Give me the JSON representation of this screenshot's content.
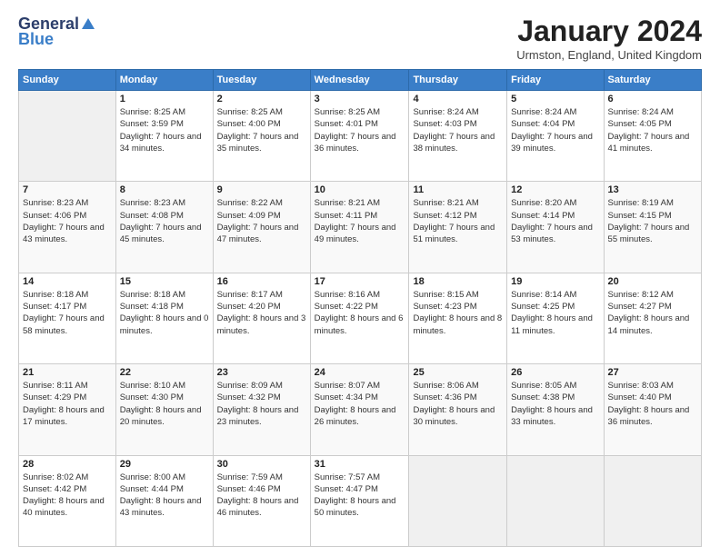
{
  "logo": {
    "general": "General",
    "blue": "Blue"
  },
  "header": {
    "month": "January 2024",
    "location": "Urmston, England, United Kingdom"
  },
  "days_of_week": [
    "Sunday",
    "Monday",
    "Tuesday",
    "Wednesday",
    "Thursday",
    "Friday",
    "Saturday"
  ],
  "weeks": [
    [
      {
        "num": "",
        "sunrise": "",
        "sunset": "",
        "daylight": ""
      },
      {
        "num": "1",
        "sunrise": "Sunrise: 8:25 AM",
        "sunset": "Sunset: 3:59 PM",
        "daylight": "Daylight: 7 hours and 34 minutes."
      },
      {
        "num": "2",
        "sunrise": "Sunrise: 8:25 AM",
        "sunset": "Sunset: 4:00 PM",
        "daylight": "Daylight: 7 hours and 35 minutes."
      },
      {
        "num": "3",
        "sunrise": "Sunrise: 8:25 AM",
        "sunset": "Sunset: 4:01 PM",
        "daylight": "Daylight: 7 hours and 36 minutes."
      },
      {
        "num": "4",
        "sunrise": "Sunrise: 8:24 AM",
        "sunset": "Sunset: 4:03 PM",
        "daylight": "Daylight: 7 hours and 38 minutes."
      },
      {
        "num": "5",
        "sunrise": "Sunrise: 8:24 AM",
        "sunset": "Sunset: 4:04 PM",
        "daylight": "Daylight: 7 hours and 39 minutes."
      },
      {
        "num": "6",
        "sunrise": "Sunrise: 8:24 AM",
        "sunset": "Sunset: 4:05 PM",
        "daylight": "Daylight: 7 hours and 41 minutes."
      }
    ],
    [
      {
        "num": "7",
        "sunrise": "Sunrise: 8:23 AM",
        "sunset": "Sunset: 4:06 PM",
        "daylight": "Daylight: 7 hours and 43 minutes."
      },
      {
        "num": "8",
        "sunrise": "Sunrise: 8:23 AM",
        "sunset": "Sunset: 4:08 PM",
        "daylight": "Daylight: 7 hours and 45 minutes."
      },
      {
        "num": "9",
        "sunrise": "Sunrise: 8:22 AM",
        "sunset": "Sunset: 4:09 PM",
        "daylight": "Daylight: 7 hours and 47 minutes."
      },
      {
        "num": "10",
        "sunrise": "Sunrise: 8:21 AM",
        "sunset": "Sunset: 4:11 PM",
        "daylight": "Daylight: 7 hours and 49 minutes."
      },
      {
        "num": "11",
        "sunrise": "Sunrise: 8:21 AM",
        "sunset": "Sunset: 4:12 PM",
        "daylight": "Daylight: 7 hours and 51 minutes."
      },
      {
        "num": "12",
        "sunrise": "Sunrise: 8:20 AM",
        "sunset": "Sunset: 4:14 PM",
        "daylight": "Daylight: 7 hours and 53 minutes."
      },
      {
        "num": "13",
        "sunrise": "Sunrise: 8:19 AM",
        "sunset": "Sunset: 4:15 PM",
        "daylight": "Daylight: 7 hours and 55 minutes."
      }
    ],
    [
      {
        "num": "14",
        "sunrise": "Sunrise: 8:18 AM",
        "sunset": "Sunset: 4:17 PM",
        "daylight": "Daylight: 7 hours and 58 minutes."
      },
      {
        "num": "15",
        "sunrise": "Sunrise: 8:18 AM",
        "sunset": "Sunset: 4:18 PM",
        "daylight": "Daylight: 8 hours and 0 minutes."
      },
      {
        "num": "16",
        "sunrise": "Sunrise: 8:17 AM",
        "sunset": "Sunset: 4:20 PM",
        "daylight": "Daylight: 8 hours and 3 minutes."
      },
      {
        "num": "17",
        "sunrise": "Sunrise: 8:16 AM",
        "sunset": "Sunset: 4:22 PM",
        "daylight": "Daylight: 8 hours and 6 minutes."
      },
      {
        "num": "18",
        "sunrise": "Sunrise: 8:15 AM",
        "sunset": "Sunset: 4:23 PM",
        "daylight": "Daylight: 8 hours and 8 minutes."
      },
      {
        "num": "19",
        "sunrise": "Sunrise: 8:14 AM",
        "sunset": "Sunset: 4:25 PM",
        "daylight": "Daylight: 8 hours and 11 minutes."
      },
      {
        "num": "20",
        "sunrise": "Sunrise: 8:12 AM",
        "sunset": "Sunset: 4:27 PM",
        "daylight": "Daylight: 8 hours and 14 minutes."
      }
    ],
    [
      {
        "num": "21",
        "sunrise": "Sunrise: 8:11 AM",
        "sunset": "Sunset: 4:29 PM",
        "daylight": "Daylight: 8 hours and 17 minutes."
      },
      {
        "num": "22",
        "sunrise": "Sunrise: 8:10 AM",
        "sunset": "Sunset: 4:30 PM",
        "daylight": "Daylight: 8 hours and 20 minutes."
      },
      {
        "num": "23",
        "sunrise": "Sunrise: 8:09 AM",
        "sunset": "Sunset: 4:32 PM",
        "daylight": "Daylight: 8 hours and 23 minutes."
      },
      {
        "num": "24",
        "sunrise": "Sunrise: 8:07 AM",
        "sunset": "Sunset: 4:34 PM",
        "daylight": "Daylight: 8 hours and 26 minutes."
      },
      {
        "num": "25",
        "sunrise": "Sunrise: 8:06 AM",
        "sunset": "Sunset: 4:36 PM",
        "daylight": "Daylight: 8 hours and 30 minutes."
      },
      {
        "num": "26",
        "sunrise": "Sunrise: 8:05 AM",
        "sunset": "Sunset: 4:38 PM",
        "daylight": "Daylight: 8 hours and 33 minutes."
      },
      {
        "num": "27",
        "sunrise": "Sunrise: 8:03 AM",
        "sunset": "Sunset: 4:40 PM",
        "daylight": "Daylight: 8 hours and 36 minutes."
      }
    ],
    [
      {
        "num": "28",
        "sunrise": "Sunrise: 8:02 AM",
        "sunset": "Sunset: 4:42 PM",
        "daylight": "Daylight: 8 hours and 40 minutes."
      },
      {
        "num": "29",
        "sunrise": "Sunrise: 8:00 AM",
        "sunset": "Sunset: 4:44 PM",
        "daylight": "Daylight: 8 hours and 43 minutes."
      },
      {
        "num": "30",
        "sunrise": "Sunrise: 7:59 AM",
        "sunset": "Sunset: 4:46 PM",
        "daylight": "Daylight: 8 hours and 46 minutes."
      },
      {
        "num": "31",
        "sunrise": "Sunrise: 7:57 AM",
        "sunset": "Sunset: 4:47 PM",
        "daylight": "Daylight: 8 hours and 50 minutes."
      },
      {
        "num": "",
        "sunrise": "",
        "sunset": "",
        "daylight": ""
      },
      {
        "num": "",
        "sunrise": "",
        "sunset": "",
        "daylight": ""
      },
      {
        "num": "",
        "sunrise": "",
        "sunset": "",
        "daylight": ""
      }
    ]
  ]
}
